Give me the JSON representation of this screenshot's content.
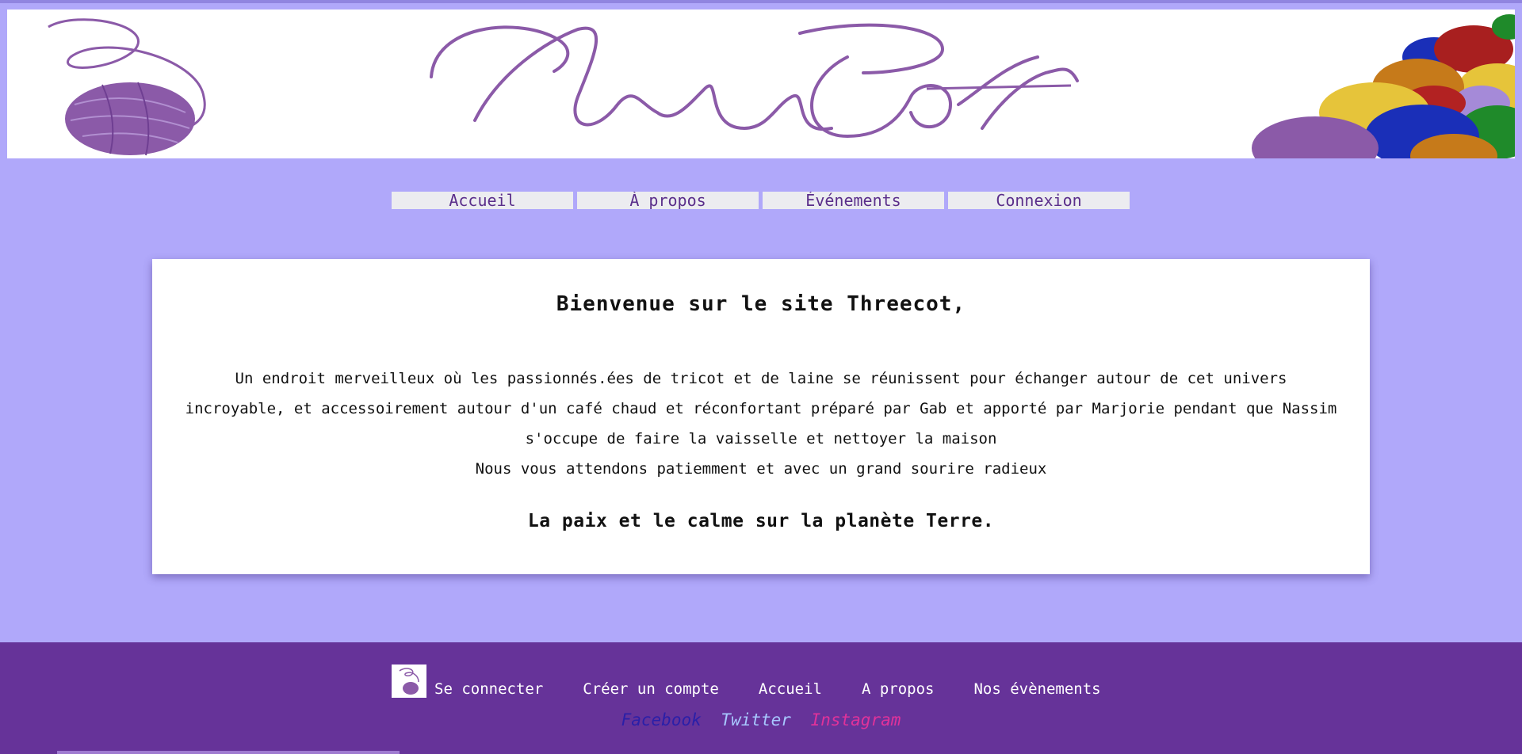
{
  "banner": {
    "logo_text": "ThreeCot"
  },
  "nav": {
    "items": [
      {
        "label": "Accueil"
      },
      {
        "label": "À propos"
      },
      {
        "label": "Événements"
      },
      {
        "label": "Connexion"
      }
    ]
  },
  "main": {
    "title": "Bienvenue sur le site Threecot,",
    "paragraph_1": "Un endroit merveilleux où les passionnés.ées de tricot et de laine se réunissent pour échanger autour de cet univers incroyable, et accessoirement autour d'un café chaud et réconfortant préparé par Gab et apporté par Marjorie pendant que Nassim s'occupe de faire la vaisselle et nettoyer la maison",
    "paragraph_2": "Nous vous attendons patiemment et avec un grand sourire radieux",
    "slogan": "La paix et le calme sur la planète Terre."
  },
  "footer": {
    "links": [
      {
        "label": "Se connecter"
      },
      {
        "label": "Créer un compte"
      },
      {
        "label": "Accueil"
      },
      {
        "label": "A propos"
      },
      {
        "label": "Nos évènements"
      }
    ],
    "social": {
      "facebook": "Facebook",
      "twitter": "Twitter",
      "instagram": "Instagram"
    }
  },
  "colors": {
    "page_background": "#b0a8fa",
    "footer_background": "#663399",
    "logo_purple": "#8b5aa8",
    "facebook": "#2a1fa8",
    "twitter": "#a8c8ff",
    "instagram": "#e0329a"
  }
}
